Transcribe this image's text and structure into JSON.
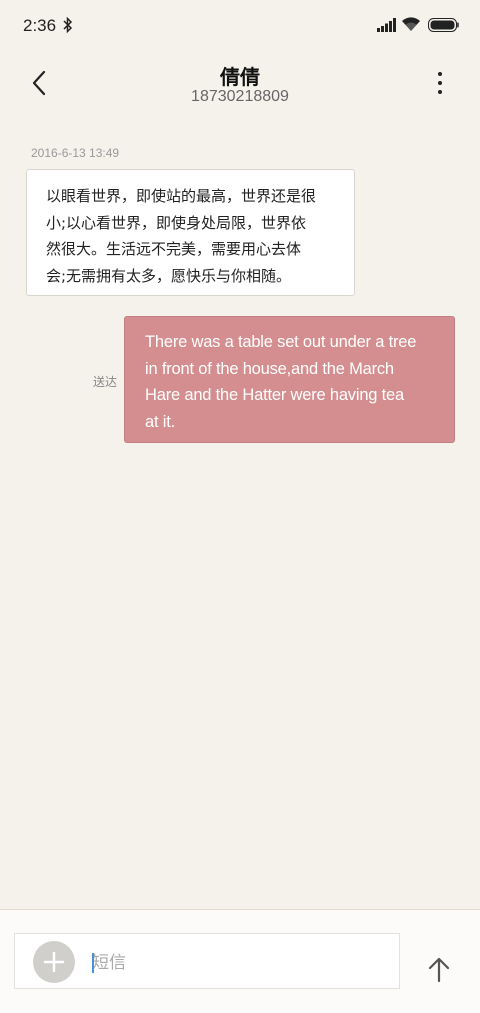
{
  "status_bar": {
    "time": "2:36",
    "icons": [
      "bluetooth-icon",
      "signal-icon",
      "wifi-icon",
      "battery-icon"
    ]
  },
  "header": {
    "back_icon": "chevron-left-icon",
    "contact_name": "倩倩",
    "phone_number": "18730218809",
    "more_icon": "more-vertical-icon"
  },
  "conversation": {
    "timestamp": "2016-6-13 13:49",
    "incoming_message": {
      "lines": [
        "以眼看世界，即使站的最高，世界还是很",
        "小;以心看世界，即使身处局限，世界依",
        "然很大。生活远不完美，需要用心去体",
        "会;无需拥有太多，愿快乐与你相随。"
      ]
    },
    "outgoing_message": {
      "status": "送达",
      "lines": [
        "There was a table set out under a tree",
        "in front of the house,and the March",
        "Hare and the Hatter were having tea",
        "at it."
      ]
    }
  },
  "composer": {
    "add_icon": "plus-icon",
    "placeholder": "短信",
    "value": "",
    "send_icon": "arrow-up-icon"
  },
  "colors": {
    "background": "#f5f2ec",
    "outgoing_bubble": "#d48e8f",
    "incoming_bubble": "#ffffff",
    "cursor": "#4a90d9"
  }
}
